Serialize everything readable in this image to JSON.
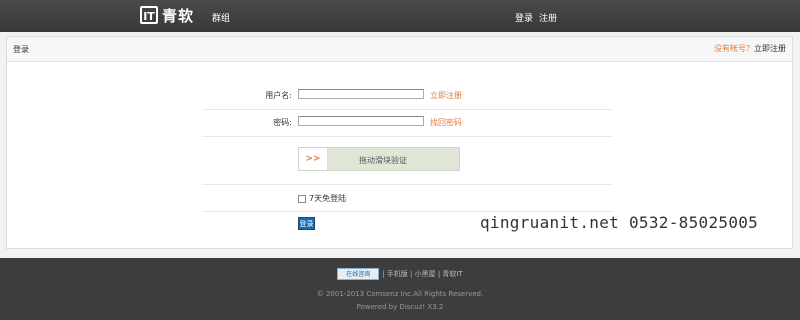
{
  "header": {
    "logo_mark": "IT",
    "logo_text": "青软",
    "nav_group": "群组",
    "login": "登录",
    "register": "注册"
  },
  "panel": {
    "title": "登录",
    "no_account": "没有帐号？",
    "register_now": "立即注册"
  },
  "form": {
    "username_label": "用户名:",
    "username_value": "",
    "username_link": "立即注册",
    "password_label": "密码:",
    "password_value": "",
    "password_link": "找回密码",
    "slider_handle": ">>",
    "slider_text": "拖动滑块验证",
    "remember_label": "7天免登陆",
    "remember_checked": false,
    "submit_label": "登录"
  },
  "watermark": "qingruanit.net 0532-85025005",
  "footer": {
    "badge": "在线咨询",
    "links": "| 手机版 | 小黑屋 | 青软IT",
    "copyright": "© 2001-2013 Comsenz Inc.All Rights Reserved.",
    "powered": "Powered by Discuz! X3.2"
  },
  "colors": {
    "accent": "#e27a3f",
    "button": "#1a69a8",
    "topbar": "#404040",
    "footer": "#3d3d3d"
  }
}
